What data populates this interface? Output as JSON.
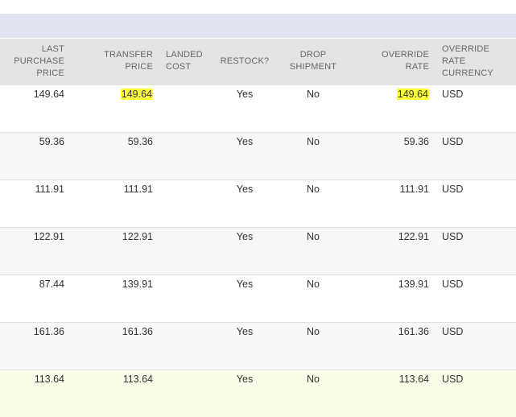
{
  "headers": {
    "last_purchase_price": "LAST PURCHASE PRICE",
    "transfer_price": "TRANSFER PRICE",
    "landed_cost": "LANDED COST",
    "restock": "RESTOCK?",
    "drop_shipment": "DROP SHIPMENT",
    "override_rate": "OVERRIDE RATE",
    "override_rate_currency": "OVERRIDE RATE CURRENCY"
  },
  "rows": [
    {
      "last_purchase_price": "149.64",
      "transfer_price": "149.64",
      "landed_cost": "",
      "restock": "Yes",
      "drop_shipment": "No",
      "override_rate": "149.64",
      "currency": "USD"
    },
    {
      "last_purchase_price": "59.36",
      "transfer_price": "59.36",
      "landed_cost": "",
      "restock": "Yes",
      "drop_shipment": "No",
      "override_rate": "59.36",
      "currency": "USD"
    },
    {
      "last_purchase_price": "111.91",
      "transfer_price": "111.91",
      "landed_cost": "",
      "restock": "Yes",
      "drop_shipment": "No",
      "override_rate": "111.91",
      "currency": "USD"
    },
    {
      "last_purchase_price": "122.91",
      "transfer_price": "122.91",
      "landed_cost": "",
      "restock": "Yes",
      "drop_shipment": "No",
      "override_rate": "122.91",
      "currency": "USD"
    },
    {
      "last_purchase_price": "87.44",
      "transfer_price": "139.91",
      "landed_cost": "",
      "restock": "Yes",
      "drop_shipment": "No",
      "override_rate": "139.91",
      "currency": "USD"
    },
    {
      "last_purchase_price": "161.36",
      "transfer_price": "161.36",
      "landed_cost": "",
      "restock": "Yes",
      "drop_shipment": "No",
      "override_rate": "161.36",
      "currency": "USD"
    },
    {
      "last_purchase_price": "113.64",
      "transfer_price": "113.64",
      "landed_cost": "",
      "restock": "Yes",
      "drop_shipment": "No",
      "override_rate": "113.64",
      "currency": "USD"
    }
  ],
  "colors": {
    "header_band": "#dfe4f0",
    "header_bg": "#e4e4e4",
    "highlight": "#ffff3a",
    "hover_row": "#fbfde8"
  }
}
